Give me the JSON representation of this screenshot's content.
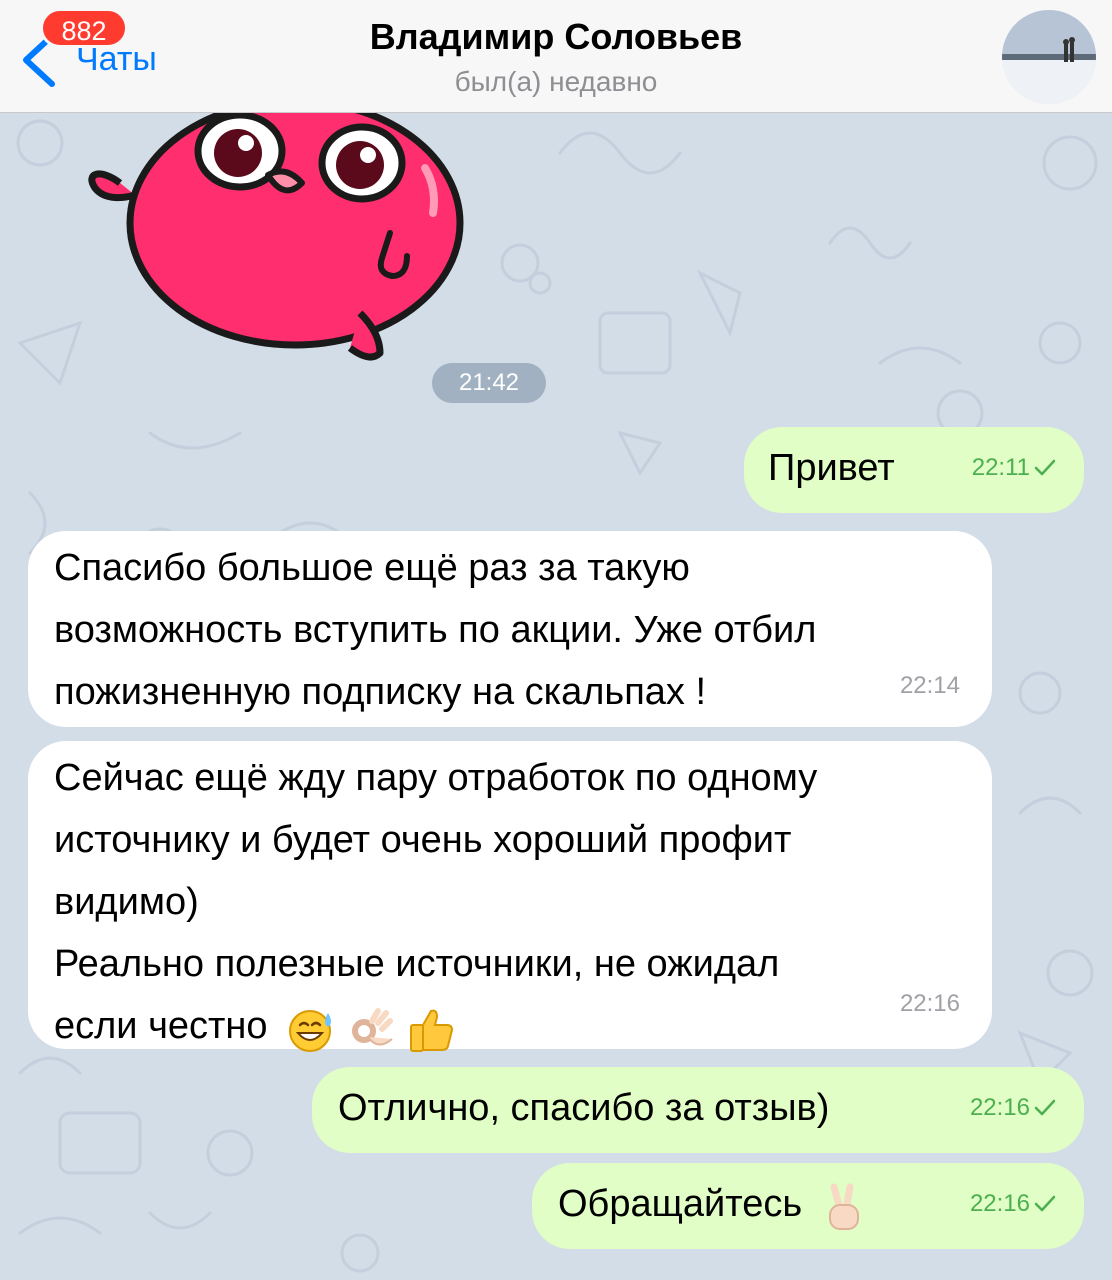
{
  "header": {
    "back_label": "Чаты",
    "unread_count": "882",
    "title": "Владимир Соловьев",
    "status": "был(а) недавно"
  },
  "chat": {
    "sticker_time": "21:42",
    "messages": [
      {
        "direction": "outgoing",
        "text": "Привет",
        "time": "22:11",
        "read_icon": "check-icon"
      },
      {
        "direction": "incoming",
        "text": "Спасибо большое ещё раз за такую\nвозможность вступить по акции. Уже отбил\nпожизненную подписку на скальпах !",
        "time": "22:14"
      },
      {
        "direction": "incoming",
        "text": "Сейчас ещё жду пару отработок по одному\nисточнику и будет очень хороший профит\nвидимо)\nРеально полезные источники, не ожидал\nесли честно",
        "emojis": [
          "grinning-sweat-emoji",
          "ok-hand-emoji",
          "thumbs-up-emoji"
        ],
        "time": "22:16"
      },
      {
        "direction": "outgoing",
        "text": "Отлично, спасибо за отзыв)",
        "time": "22:16",
        "read_icon": "check-icon"
      },
      {
        "direction": "outgoing",
        "text": "Обращайтесь",
        "emojis": [
          "victory-hand-emoji"
        ],
        "time": "22:16",
        "read_icon": "check-icon"
      }
    ]
  },
  "colors": {
    "accent": "#007aff",
    "badge": "#ff3b30",
    "outgoing_bubble": "#e1fec6",
    "incoming_bubble": "#ffffff",
    "chat_background": "#d3dde8",
    "outgoing_meta": "#4caf50"
  }
}
